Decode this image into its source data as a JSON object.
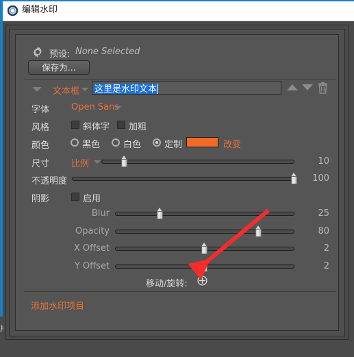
{
  "window": {
    "title": "编辑水印",
    "icon": "ring-icon"
  },
  "preset": {
    "icon": "gear-icon",
    "label": "预设:",
    "value": "None Selected",
    "save_as_label": "保存为..."
  },
  "item": {
    "collapse_icon": "triangle-down-icon",
    "type_label": "文本框",
    "type_caret": "chevron-down-icon",
    "text_value": "这里是水印文本",
    "move_up_icon": "triangle-up-icon",
    "move_down_icon": "triangle-down-icon",
    "delete_icon": "trash-icon"
  },
  "font": {
    "label": "字体",
    "value": "Open Sans",
    "caret": "chevron-down-icon"
  },
  "style": {
    "label": "风格",
    "italic": {
      "label": "斜体字",
      "checked": false
    },
    "bold": {
      "label": "加粗",
      "checked": false
    }
  },
  "color": {
    "label": "颜色",
    "options": [
      {
        "label": "黑色",
        "selected": false
      },
      {
        "label": "白色",
        "selected": false
      },
      {
        "label": "定制",
        "selected": true
      }
    ],
    "swatch_hex": "#F26A28",
    "change_label": "改变"
  },
  "size": {
    "label": "尺寸",
    "mode": "比例",
    "mode_caret": "chevron-down-icon",
    "value": "10",
    "percent": 12
  },
  "opacity": {
    "label": "不透明度",
    "value": "100",
    "percent": 100
  },
  "shadow": {
    "label": "阴影",
    "enable": {
      "label": "启用",
      "checked": false
    },
    "rows": [
      {
        "name": "blur",
        "label": "Blur",
        "value": "25",
        "percent": 25
      },
      {
        "name": "opacity",
        "label": "Opacity",
        "value": "80",
        "percent": 80
      },
      {
        "name": "x-offset",
        "label": "X Offset",
        "value": "2",
        "percent": 50
      },
      {
        "name": "y-offset",
        "label": "Y Offset",
        "value": "2",
        "percent": 50
      }
    ]
  },
  "move_rotate": {
    "label": "移动/旋转:",
    "icon": "plus-circle-icon"
  },
  "add_item": {
    "label": "添加水印项目"
  },
  "colors": {
    "accent_orange": "#E8713A",
    "panel_bg": "#555555",
    "window_bg": "#4A4A4A",
    "titlebar_bg": "#FFFFFF",
    "selection_blue": "#1A6FD4",
    "annotation_red": "#F42C2C"
  }
}
